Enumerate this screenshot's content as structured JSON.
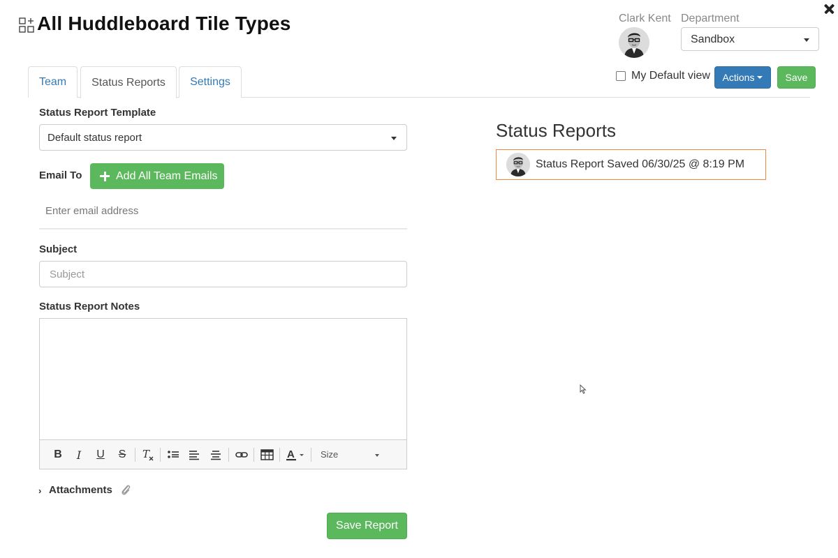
{
  "header": {
    "title": "All Huddleboard Tile Types",
    "user_name": "Clark Kent",
    "department_label": "Department",
    "department_value": "Sandbox",
    "default_view_label": "My Default view",
    "default_view_checked": false,
    "actions_label": "Actions",
    "save_label": "Save"
  },
  "tabs": [
    {
      "label": "Team",
      "active": false
    },
    {
      "label": "Status Reports",
      "active": true
    },
    {
      "label": "Settings",
      "active": false
    }
  ],
  "form": {
    "template_label": "Status Report Template",
    "template_value": "Default status report",
    "email_label": "Email To",
    "add_emails_label": "Add All Team Emails",
    "email_placeholder": "Enter email address",
    "subject_label": "Subject",
    "subject_placeholder": "Subject",
    "notes_label": "Status Report Notes",
    "toolbar": {
      "bold": "B",
      "italic": "I",
      "underline": "U",
      "strike": "S",
      "size_label": "Size"
    },
    "attachments_label": "Attachments",
    "save_report_label": "Save Report"
  },
  "reports": {
    "heading": "Status Reports",
    "items": [
      {
        "text": "Status Report Saved 06/30/25 @ 8:19 PM"
      }
    ]
  },
  "colors": {
    "primary": "#337ab7",
    "success": "#5cb85c",
    "highlight_border": "#f0883e"
  }
}
